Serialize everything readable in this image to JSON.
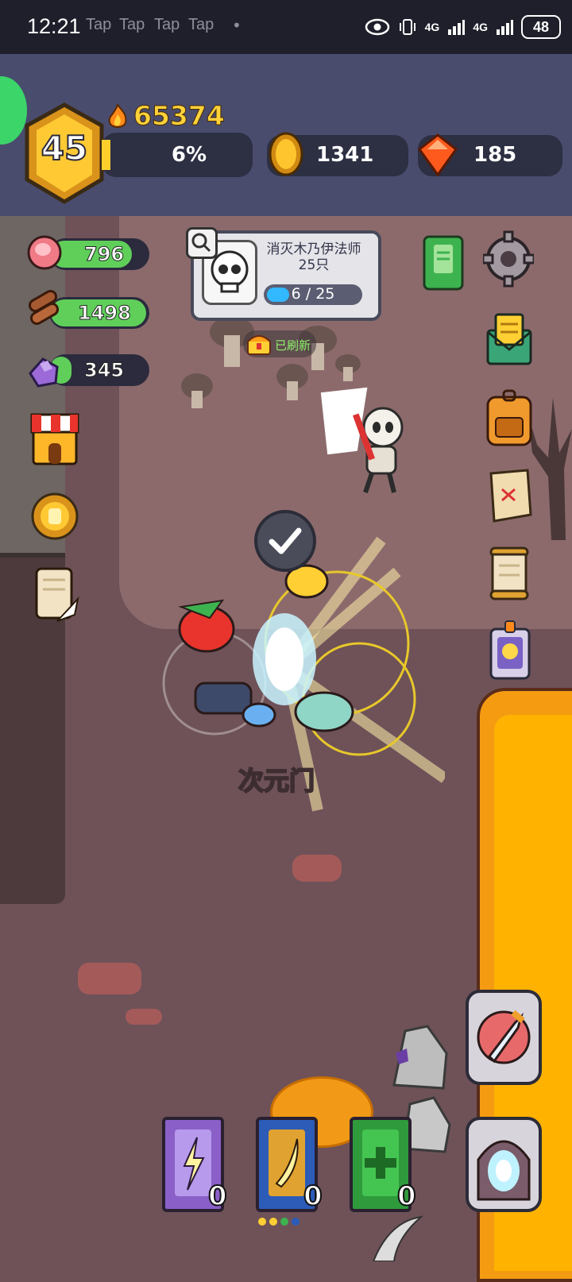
{
  "status_bar": {
    "time": "12:21",
    "tap_labels": [
      "Tap",
      "Tap",
      "Tap",
      "Tap"
    ],
    "dot": "•",
    "network": [
      "4G",
      "4G"
    ],
    "battery": "48"
  },
  "header": {
    "level": "45",
    "power": "65374",
    "xp_percent_label": "6%",
    "xp_fraction": 0.06,
    "gold": "1341",
    "gems": "185"
  },
  "resources": [
    {
      "name": "meat",
      "value": "796"
    },
    {
      "name": "wood",
      "value": "1498"
    },
    {
      "name": "ore",
      "value": "345"
    }
  ],
  "quest": {
    "title": "消灭木乃伊法师25只",
    "progress_label": "6 / 25",
    "current": 6,
    "total": 25,
    "refresh_label": "已刷新"
  },
  "map": {
    "gate_label": "次元门"
  },
  "books": [
    {
      "color": "purple",
      "icon": "lightning-icon",
      "count": "0"
    },
    {
      "color": "blue",
      "icon": "wing-icon",
      "count": "0"
    },
    {
      "color": "green",
      "icon": "plus-icon",
      "count": "0"
    }
  ],
  "colors": {
    "header_bg": "#494c6d",
    "gold_text": "#ffd23b",
    "resource_fill": "#5fcf5a",
    "quest_bar": "#32b8ff",
    "lava": "#ffb300"
  }
}
